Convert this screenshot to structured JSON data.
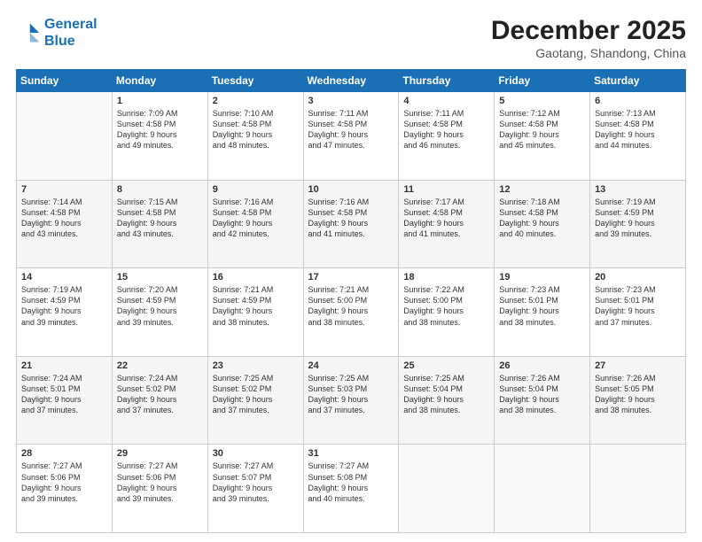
{
  "header": {
    "logo_line1": "General",
    "logo_line2": "Blue",
    "month": "December 2025",
    "location": "Gaotang, Shandong, China"
  },
  "weekdays": [
    "Sunday",
    "Monday",
    "Tuesday",
    "Wednesday",
    "Thursday",
    "Friday",
    "Saturday"
  ],
  "weeks": [
    [
      {
        "num": "",
        "info": ""
      },
      {
        "num": "1",
        "info": "Sunrise: 7:09 AM\nSunset: 4:58 PM\nDaylight: 9 hours\nand 49 minutes."
      },
      {
        "num": "2",
        "info": "Sunrise: 7:10 AM\nSunset: 4:58 PM\nDaylight: 9 hours\nand 48 minutes."
      },
      {
        "num": "3",
        "info": "Sunrise: 7:11 AM\nSunset: 4:58 PM\nDaylight: 9 hours\nand 47 minutes."
      },
      {
        "num": "4",
        "info": "Sunrise: 7:11 AM\nSunset: 4:58 PM\nDaylight: 9 hours\nand 46 minutes."
      },
      {
        "num": "5",
        "info": "Sunrise: 7:12 AM\nSunset: 4:58 PM\nDaylight: 9 hours\nand 45 minutes."
      },
      {
        "num": "6",
        "info": "Sunrise: 7:13 AM\nSunset: 4:58 PM\nDaylight: 9 hours\nand 44 minutes."
      }
    ],
    [
      {
        "num": "7",
        "info": "Sunrise: 7:14 AM\nSunset: 4:58 PM\nDaylight: 9 hours\nand 43 minutes."
      },
      {
        "num": "8",
        "info": "Sunrise: 7:15 AM\nSunset: 4:58 PM\nDaylight: 9 hours\nand 43 minutes."
      },
      {
        "num": "9",
        "info": "Sunrise: 7:16 AM\nSunset: 4:58 PM\nDaylight: 9 hours\nand 42 minutes."
      },
      {
        "num": "10",
        "info": "Sunrise: 7:16 AM\nSunset: 4:58 PM\nDaylight: 9 hours\nand 41 minutes."
      },
      {
        "num": "11",
        "info": "Sunrise: 7:17 AM\nSunset: 4:58 PM\nDaylight: 9 hours\nand 41 minutes."
      },
      {
        "num": "12",
        "info": "Sunrise: 7:18 AM\nSunset: 4:58 PM\nDaylight: 9 hours\nand 40 minutes."
      },
      {
        "num": "13",
        "info": "Sunrise: 7:19 AM\nSunset: 4:59 PM\nDaylight: 9 hours\nand 39 minutes."
      }
    ],
    [
      {
        "num": "14",
        "info": "Sunrise: 7:19 AM\nSunset: 4:59 PM\nDaylight: 9 hours\nand 39 minutes."
      },
      {
        "num": "15",
        "info": "Sunrise: 7:20 AM\nSunset: 4:59 PM\nDaylight: 9 hours\nand 39 minutes."
      },
      {
        "num": "16",
        "info": "Sunrise: 7:21 AM\nSunset: 4:59 PM\nDaylight: 9 hours\nand 38 minutes."
      },
      {
        "num": "17",
        "info": "Sunrise: 7:21 AM\nSunset: 5:00 PM\nDaylight: 9 hours\nand 38 minutes."
      },
      {
        "num": "18",
        "info": "Sunrise: 7:22 AM\nSunset: 5:00 PM\nDaylight: 9 hours\nand 38 minutes."
      },
      {
        "num": "19",
        "info": "Sunrise: 7:23 AM\nSunset: 5:01 PM\nDaylight: 9 hours\nand 38 minutes."
      },
      {
        "num": "20",
        "info": "Sunrise: 7:23 AM\nSunset: 5:01 PM\nDaylight: 9 hours\nand 37 minutes."
      }
    ],
    [
      {
        "num": "21",
        "info": "Sunrise: 7:24 AM\nSunset: 5:01 PM\nDaylight: 9 hours\nand 37 minutes."
      },
      {
        "num": "22",
        "info": "Sunrise: 7:24 AM\nSunset: 5:02 PM\nDaylight: 9 hours\nand 37 minutes."
      },
      {
        "num": "23",
        "info": "Sunrise: 7:25 AM\nSunset: 5:02 PM\nDaylight: 9 hours\nand 37 minutes."
      },
      {
        "num": "24",
        "info": "Sunrise: 7:25 AM\nSunset: 5:03 PM\nDaylight: 9 hours\nand 37 minutes."
      },
      {
        "num": "25",
        "info": "Sunrise: 7:25 AM\nSunset: 5:04 PM\nDaylight: 9 hours\nand 38 minutes."
      },
      {
        "num": "26",
        "info": "Sunrise: 7:26 AM\nSunset: 5:04 PM\nDaylight: 9 hours\nand 38 minutes."
      },
      {
        "num": "27",
        "info": "Sunrise: 7:26 AM\nSunset: 5:05 PM\nDaylight: 9 hours\nand 38 minutes."
      }
    ],
    [
      {
        "num": "28",
        "info": "Sunrise: 7:27 AM\nSunset: 5:06 PM\nDaylight: 9 hours\nand 39 minutes."
      },
      {
        "num": "29",
        "info": "Sunrise: 7:27 AM\nSunset: 5:06 PM\nDaylight: 9 hours\nand 39 minutes."
      },
      {
        "num": "30",
        "info": "Sunrise: 7:27 AM\nSunset: 5:07 PM\nDaylight: 9 hours\nand 39 minutes."
      },
      {
        "num": "31",
        "info": "Sunrise: 7:27 AM\nSunset: 5:08 PM\nDaylight: 9 hours\nand 40 minutes."
      },
      {
        "num": "",
        "info": ""
      },
      {
        "num": "",
        "info": ""
      },
      {
        "num": "",
        "info": ""
      }
    ]
  ]
}
